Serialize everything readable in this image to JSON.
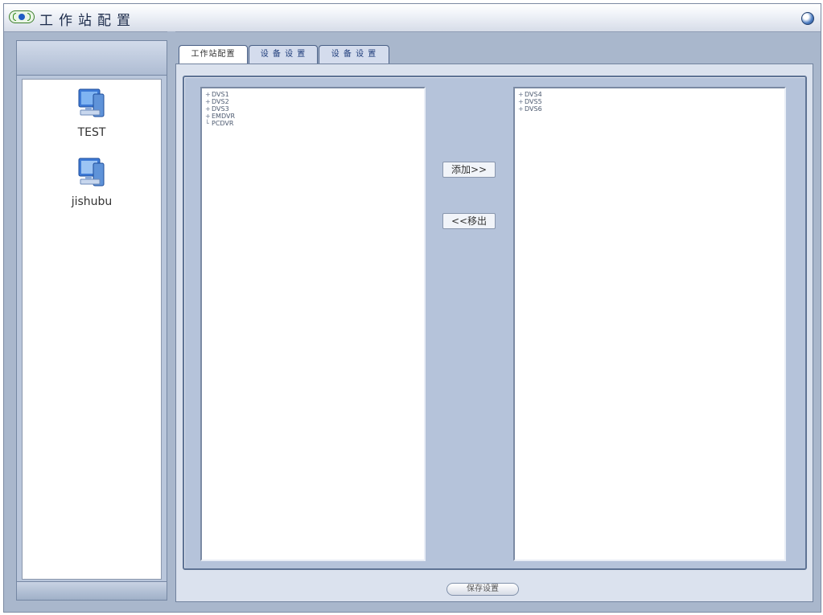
{
  "window": {
    "title": "工作站配置"
  },
  "sidebar": {
    "stations": [
      {
        "name": "TEST"
      },
      {
        "name": "jishubu"
      }
    ]
  },
  "tabs": [
    {
      "label": "工作站配置",
      "active": true
    },
    {
      "label": "设 备 设 置",
      "active": false
    },
    {
      "label": "设 备 设 置",
      "active": false
    }
  ],
  "left_tree": {
    "items": [
      {
        "label": "DVS1",
        "expander": "+"
      },
      {
        "label": "DVS2",
        "expander": "+"
      },
      {
        "label": "DVS3",
        "expander": "+"
      },
      {
        "label": "EMDVR",
        "expander": "+"
      },
      {
        "label": "PCDVR",
        "expander": ""
      }
    ]
  },
  "right_tree": {
    "items": [
      {
        "label": "DVS4",
        "expander": "+"
      },
      {
        "label": "DVS5",
        "expander": "+"
      },
      {
        "label": "DVS6",
        "expander": "+"
      }
    ]
  },
  "buttons": {
    "add": "添加>>",
    "remove": "<<移出",
    "save": "保存设置"
  }
}
